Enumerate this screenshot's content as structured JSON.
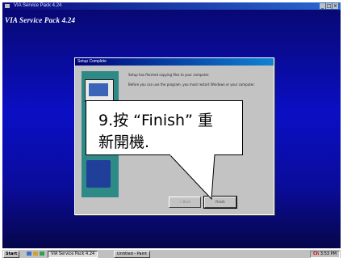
{
  "window": {
    "title": "VIA Service Pack 4.24",
    "controls": [
      "_",
      "□",
      "×"
    ]
  },
  "app_title": "VIA Service Pack 4.24",
  "dialog": {
    "title": "Setup Complete",
    "text_line1": "Setup has finished copying files to your computer.",
    "text_line2": "Before you can use the program, you must restart Windows or your computer.",
    "back_label": "< Back",
    "finish_label": "Finish"
  },
  "callout": {
    "line1": "9.按 “Finish” 重",
    "line2": "新開機."
  },
  "taskbar": {
    "start_label": "Start",
    "tasks": [
      {
        "label": "VIA Service Pack 4.24",
        "active": true
      },
      {
        "label": "Untitled - Paint",
        "active": false
      }
    ],
    "tray_ime": "Ch",
    "tray_clock": "3:53 PM"
  },
  "colors": {
    "desktop_top": "#08086e",
    "desktop_mid": "#0a0fc4",
    "dialog_face": "#c3c3c3",
    "graphic_teal": "#2e8a86"
  }
}
